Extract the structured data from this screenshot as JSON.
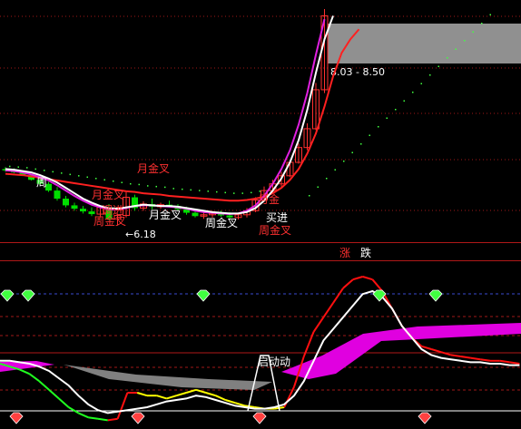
{
  "colors": {
    "background": "#000000",
    "divider": "#b01818",
    "grid_dotted": "#a01818",
    "grid_blue_dashed": "#3a4ad0",
    "up_candle": "#ff3030",
    "down_candle": "#00dd00",
    "ma_red": "#ff2020",
    "ma_white": "#ffffff",
    "ma_magenta": "#e020e0",
    "label_red": "#ff3030",
    "label_white": "#ffffff",
    "box_fill": "#909090",
    "green_dots": "#40ff40",
    "osc_red": "#ff1010",
    "osc_green": "#20ff20",
    "osc_yellow": "#ffff00",
    "osc_white": "#ffffff",
    "band_magenta": "#e000e0",
    "band_gray": "#808080",
    "gem_green": "#40ff40",
    "gem_red": "#ff4040"
  },
  "upper": {
    "price_box_label": "8.03 - 8.50",
    "low_label": "←6.18",
    "buy_label": "买进",
    "signals": [
      {
        "id": "month-gold-1",
        "text": "月金叉",
        "color": "red"
      },
      {
        "id": "month-gold-2",
        "text": "月金叉",
        "color": "red"
      },
      {
        "id": "month-gold-3",
        "text": "月金叉",
        "color": "white"
      },
      {
        "id": "week-gold-1",
        "text": "周金叉",
        "color": "red"
      },
      {
        "id": "week-gold-2",
        "text": "周金叉",
        "color": "white"
      },
      {
        "id": "week-gold-3",
        "text": "周金叉",
        "color": "red"
      },
      {
        "id": "buy-marker",
        "text": "买进",
        "color": "white"
      },
      {
        "id": "partial-1",
        "text": "周",
        "color": "white"
      },
      {
        "id": "partial-2",
        "text": "调进",
        "color": "red"
      },
      {
        "id": "partial-3",
        "text": "月金",
        "color": "red"
      }
    ]
  },
  "middle": {
    "rise_label": "涨",
    "fall_label": "跌"
  },
  "lower": {
    "launch_label": "启动动"
  },
  "chart_data": {
    "type": "line",
    "title": "",
    "price_box": [
      8.03,
      8.5
    ],
    "recent_low": 6.18,
    "candles": [
      {
        "o": 7.02,
        "h": 7.05,
        "l": 6.98,
        "c": 7.0
      },
      {
        "o": 7.0,
        "h": 7.03,
        "l": 6.96,
        "c": 6.97
      },
      {
        "o": 6.97,
        "h": 7.0,
        "l": 6.92,
        "c": 6.93
      },
      {
        "o": 6.93,
        "h": 6.95,
        "l": 6.85,
        "c": 6.86
      },
      {
        "o": 6.86,
        "h": 6.9,
        "l": 6.78,
        "c": 6.8
      },
      {
        "o": 6.8,
        "h": 6.83,
        "l": 6.68,
        "c": 6.7
      },
      {
        "o": 6.7,
        "h": 6.75,
        "l": 6.55,
        "c": 6.58
      },
      {
        "o": 6.58,
        "h": 6.62,
        "l": 6.45,
        "c": 6.48
      },
      {
        "o": 6.48,
        "h": 6.52,
        "l": 6.4,
        "c": 6.43
      },
      {
        "o": 6.43,
        "h": 6.47,
        "l": 6.36,
        "c": 6.39
      },
      {
        "o": 6.39,
        "h": 6.45,
        "l": 6.32,
        "c": 6.35
      },
      {
        "o": 6.35,
        "h": 6.48,
        "l": 6.3,
        "c": 6.45
      },
      {
        "o": 6.45,
        "h": 6.5,
        "l": 6.26,
        "c": 6.28
      },
      {
        "o": 6.28,
        "h": 6.36,
        "l": 6.18,
        "c": 6.33
      },
      {
        "o": 6.33,
        "h": 6.68,
        "l": 6.3,
        "c": 6.6
      },
      {
        "o": 6.6,
        "h": 6.64,
        "l": 6.4,
        "c": 6.44
      },
      {
        "o": 6.44,
        "h": 6.54,
        "l": 6.4,
        "c": 6.5
      },
      {
        "o": 6.5,
        "h": 6.58,
        "l": 6.42,
        "c": 6.46
      },
      {
        "o": 6.46,
        "h": 6.52,
        "l": 6.43,
        "c": 6.49
      },
      {
        "o": 6.49,
        "h": 6.55,
        "l": 6.45,
        "c": 6.47
      },
      {
        "o": 6.47,
        "h": 6.5,
        "l": 6.4,
        "c": 6.42
      },
      {
        "o": 6.42,
        "h": 6.46,
        "l": 6.34,
        "c": 6.37
      },
      {
        "o": 6.37,
        "h": 6.42,
        "l": 6.3,
        "c": 6.32
      },
      {
        "o": 6.32,
        "h": 6.38,
        "l": 6.28,
        "c": 6.34
      },
      {
        "o": 6.34,
        "h": 6.4,
        "l": 6.3,
        "c": 6.36
      },
      {
        "o": 6.36,
        "h": 6.4,
        "l": 6.31,
        "c": 6.33
      },
      {
        "o": 6.33,
        "h": 6.38,
        "l": 6.28,
        "c": 6.3
      },
      {
        "o": 6.3,
        "h": 6.36,
        "l": 6.27,
        "c": 6.34
      },
      {
        "o": 6.34,
        "h": 6.44,
        "l": 6.3,
        "c": 6.4
      },
      {
        "o": 6.4,
        "h": 6.6,
        "l": 6.38,
        "c": 6.56
      },
      {
        "o": 6.56,
        "h": 6.76,
        "l": 6.54,
        "c": 6.7
      },
      {
        "o": 6.7,
        "h": 6.86,
        "l": 6.66,
        "c": 6.8
      },
      {
        "o": 6.8,
        "h": 6.98,
        "l": 6.76,
        "c": 6.92
      },
      {
        "o": 6.92,
        "h": 7.16,
        "l": 6.9,
        "c": 7.12
      },
      {
        "o": 7.12,
        "h": 7.4,
        "l": 7.1,
        "c": 7.34
      },
      {
        "o": 7.34,
        "h": 7.7,
        "l": 7.3,
        "c": 7.62
      },
      {
        "o": 7.62,
        "h": 8.3,
        "l": 7.6,
        "c": 8.2
      },
      {
        "o": 8.2,
        "h": 9.4,
        "l": 8.15,
        "c": 9.3
      }
    ],
    "ma_red": [
      6.95,
      6.94,
      6.93,
      6.91,
      6.89,
      6.87,
      6.85,
      6.83,
      6.81,
      6.79,
      6.77,
      6.75,
      6.73,
      6.71,
      6.69,
      6.68,
      6.66,
      6.65,
      6.64,
      6.62,
      6.61,
      6.6,
      6.59,
      6.58,
      6.57,
      6.56,
      6.55,
      6.55,
      6.56,
      6.58,
      6.61,
      6.66,
      6.74,
      6.86,
      7.02,
      7.25,
      7.55,
      7.95,
      8.4,
      8.75,
      8.95,
      9.1
    ],
    "ma_white": [
      7.02,
      7.01,
      6.99,
      6.97,
      6.93,
      6.88,
      6.82,
      6.74,
      6.66,
      6.58,
      6.52,
      6.47,
      6.44,
      6.43,
      6.45,
      6.47,
      6.49,
      6.48,
      6.47,
      6.47,
      6.46,
      6.44,
      6.42,
      6.4,
      6.38,
      6.37,
      6.36,
      6.36,
      6.38,
      6.44,
      6.55,
      6.7,
      6.88,
      7.12,
      7.45,
      7.9,
      8.45,
      8.95,
      9.3
    ],
    "ma_magenta": [
      7.0,
      6.99,
      6.97,
      6.94,
      6.9,
      6.85,
      6.78,
      6.7,
      6.62,
      6.55,
      6.49,
      6.45,
      6.42,
      6.42,
      6.44,
      6.47,
      6.48,
      6.48,
      6.47,
      6.46,
      6.45,
      6.43,
      6.4,
      6.38,
      6.37,
      6.36,
      6.35,
      6.36,
      6.4,
      6.48,
      6.62,
      6.8,
      7.02,
      7.3,
      7.68,
      8.15,
      8.72,
      9.25
    ],
    "oscillator": {
      "y_range": [
        0,
        100
      ],
      "white": [
        42,
        42,
        41,
        40,
        38,
        35,
        30,
        25,
        18,
        12,
        8,
        6,
        7,
        8,
        9,
        10,
        12,
        14,
        15,
        16,
        18,
        17,
        15,
        13,
        11,
        10,
        9,
        9,
        10,
        12,
        18,
        28,
        42,
        56,
        64,
        72,
        80,
        88,
        90,
        86,
        78,
        66,
        58,
        50,
        46,
        44,
        43,
        42,
        41,
        41,
        40,
        40,
        39,
        39
      ],
      "red_green": [
        40,
        38,
        36,
        33,
        28,
        22,
        16,
        10,
        6,
        3,
        2,
        1,
        2,
        20,
        20,
        18,
        18,
        16,
        18,
        20,
        22,
        20,
        18,
        15,
        13,
        11,
        10,
        9,
        9,
        10,
        24,
        45,
        62,
        72,
        82,
        92,
        98,
        100,
        98,
        90,
        78,
        66,
        58,
        52,
        50,
        48,
        46,
        45,
        44,
        43,
        42,
        42,
        41,
        40
      ],
      "yellow_start": [
        40,
        40,
        39,
        38,
        37,
        35
      ]
    }
  }
}
